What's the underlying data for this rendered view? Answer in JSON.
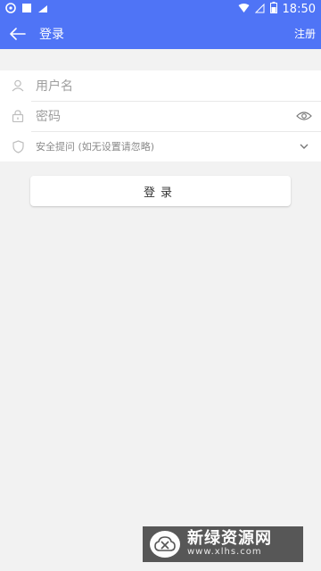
{
  "status_bar": {
    "time": "18:50",
    "icons": [
      "headset-icon",
      "square-icon",
      "notification-icon",
      "wifi-icon",
      "signal-icon",
      "battery-icon"
    ]
  },
  "appbar": {
    "back_icon": "arrow-left-icon",
    "title": "登录",
    "register_label": "注册"
  },
  "form": {
    "username_placeholder": "用户名",
    "password_placeholder": "密码",
    "security_question": "安全提问 (如无设置请忽略)"
  },
  "actions": {
    "login_label": "登录"
  },
  "watermark": {
    "name": "新绿资源网",
    "url": "www.xlhs.com"
  },
  "colors": {
    "primary": "#4f74f6",
    "background": "#f2f2f2",
    "card": "#ffffff"
  }
}
